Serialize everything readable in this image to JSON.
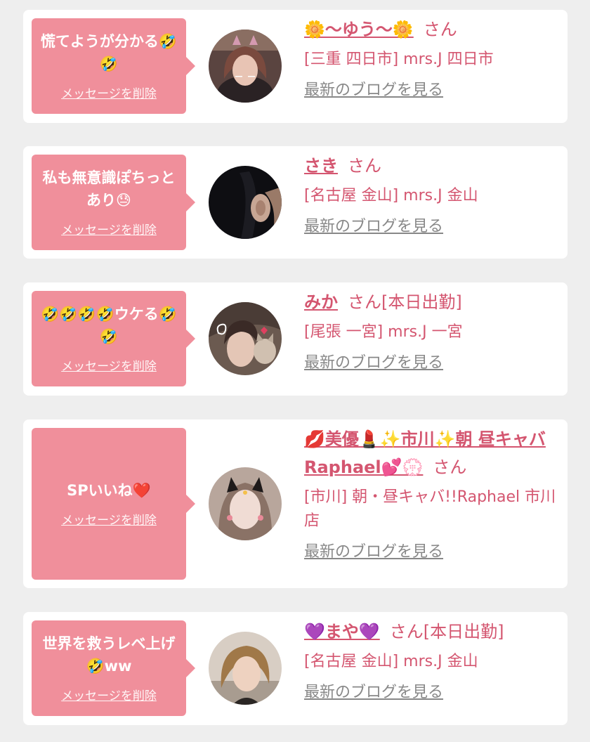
{
  "delete_label": "メッセージを削除",
  "blog_label": "最新のブログを見る",
  "colors": {
    "bubble": "#f08f9b",
    "name": "#d45670",
    "link_gray": "#888888",
    "card": "#ffffff",
    "background": "#eeeeee"
  },
  "entries": [
    {
      "message": "慌てようが分かる🤣🤣",
      "name": "🌼〜ゆう〜🌼",
      "suffix": "さん",
      "shop": "[三重 四日市] mrs.J 四日市"
    },
    {
      "message": "私も無意識ぽちっとあり😓",
      "name": "さき",
      "suffix": "さん",
      "shop": "[名古屋 金山] mrs.J 金山"
    },
    {
      "message": "🤣🤣🤣🤣ウケる🤣🤣",
      "name": "みか",
      "suffix": "さん[本日出勤]",
      "shop": "[尾張 一宮] mrs.J 一宮"
    },
    {
      "message": "SPいいね❤️",
      "name": "💋美優💄✨市川✨朝 昼キャバ Raphael💕💮",
      "suffix": "さん",
      "shop": "[市川] 朝・昼キャバ!!Raphael 市川店"
    },
    {
      "message": "世界を救うレベ上げ🤣ww",
      "name": "💜まや💜",
      "suffix": "さん[本日出勤]",
      "shop": "[名古屋 金山] mrs.J 金山"
    }
  ]
}
